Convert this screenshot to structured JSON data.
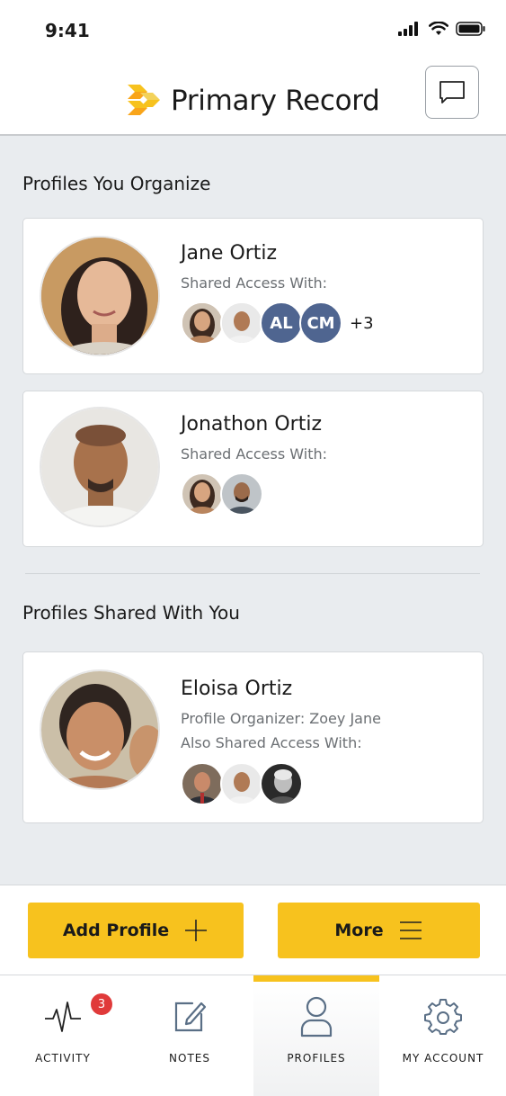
{
  "status_bar": {
    "time": "9:41"
  },
  "header": {
    "title": "Primary Record",
    "brand_color": "#f7c21e",
    "chat_icon": "chat-bubble-icon"
  },
  "sections": {
    "organize_title": "Profiles You Organize",
    "shared_title": "Profiles Shared With You"
  },
  "profiles_organized": [
    {
      "name": "Jane Ortiz",
      "shared_label": "Shared Access With:",
      "initials": [
        "AL",
        "CM"
      ],
      "more": "+3"
    },
    {
      "name": "Jonathon Ortiz",
      "shared_label": "Shared Access With:"
    }
  ],
  "profiles_shared": [
    {
      "name": "Eloisa Ortiz",
      "organizer": "Profile Organizer: Zoey Jane",
      "also_label": "Also Shared Access With:"
    }
  ],
  "actions": {
    "add_profile": "Add Profile",
    "more": "More"
  },
  "tabs": [
    {
      "label": "ACTIVITY",
      "icon": "activity-pulse-icon",
      "badge": "3"
    },
    {
      "label": "NOTES",
      "icon": "edit-note-icon"
    },
    {
      "label": "PROFILES",
      "icon": "person-icon",
      "active": true
    },
    {
      "label": "MY ACCOUNT",
      "icon": "gear-icon"
    }
  ],
  "colors": {
    "accent": "#f7c21e",
    "badge": "#e03a3a",
    "initials_bg": "#4f6590"
  }
}
